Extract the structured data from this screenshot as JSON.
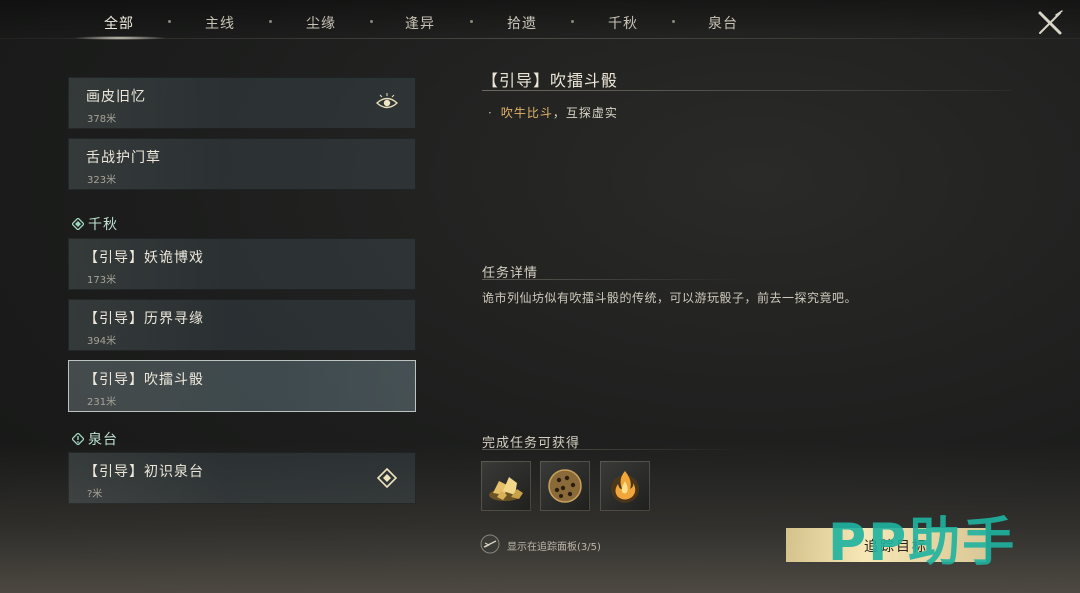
{
  "tabs": [
    {
      "label": "全部",
      "active": true
    },
    {
      "label": "主线",
      "active": false
    },
    {
      "label": "尘缘",
      "active": false
    },
    {
      "label": "逢异",
      "active": false
    },
    {
      "label": "拾遗",
      "active": false
    },
    {
      "label": "千秋",
      "active": false
    },
    {
      "label": "泉台",
      "active": false
    }
  ],
  "quest_list": {
    "top_items": [
      {
        "title": "画皮旧忆",
        "distance": "378米",
        "icon": "eye-icon"
      },
      {
        "title": "舌战护门草",
        "distance": "323米"
      }
    ],
    "sections": [
      {
        "title": "千秋",
        "icon": "diamond-icon",
        "items": [
          {
            "title": "【引导】妖诡博戏",
            "distance": "173米"
          },
          {
            "title": "【引导】历界寻缘",
            "distance": "394米"
          },
          {
            "title": "【引导】吹擂斗骰",
            "distance": "231米",
            "selected": true
          }
        ]
      },
      {
        "title": "泉台",
        "icon": "exclamation-diamond-icon",
        "items": [
          {
            "title": "【引导】初识泉台",
            "distance": "?米",
            "icon": "target-diamond-icon"
          }
        ]
      }
    ]
  },
  "detail": {
    "title": "【引导】吹擂斗骰",
    "objective_highlight": "吹牛比斗",
    "objective_rest": "，互探虚实",
    "info_heading": "任务详情",
    "description": "诡市列仙坊似有吹擂斗骰的传统，可以游玩骰子，前去一探究竟吧。",
    "rewards_heading": "完成任务可获得",
    "rewards": [
      {
        "icon": "gold-nuggets-icon"
      },
      {
        "icon": "dice-ball-icon"
      },
      {
        "icon": "flame-orb-icon"
      }
    ],
    "track_toggle_label": "显示在追踪面板(3/5)",
    "track_button_label": "追踪目标"
  },
  "watermark": "PP助手",
  "colors": {
    "highlight": "#e2b46a",
    "section_text": "#bfe0d2",
    "watermark": "#1fb3a0",
    "button": "#f3e3b0"
  }
}
